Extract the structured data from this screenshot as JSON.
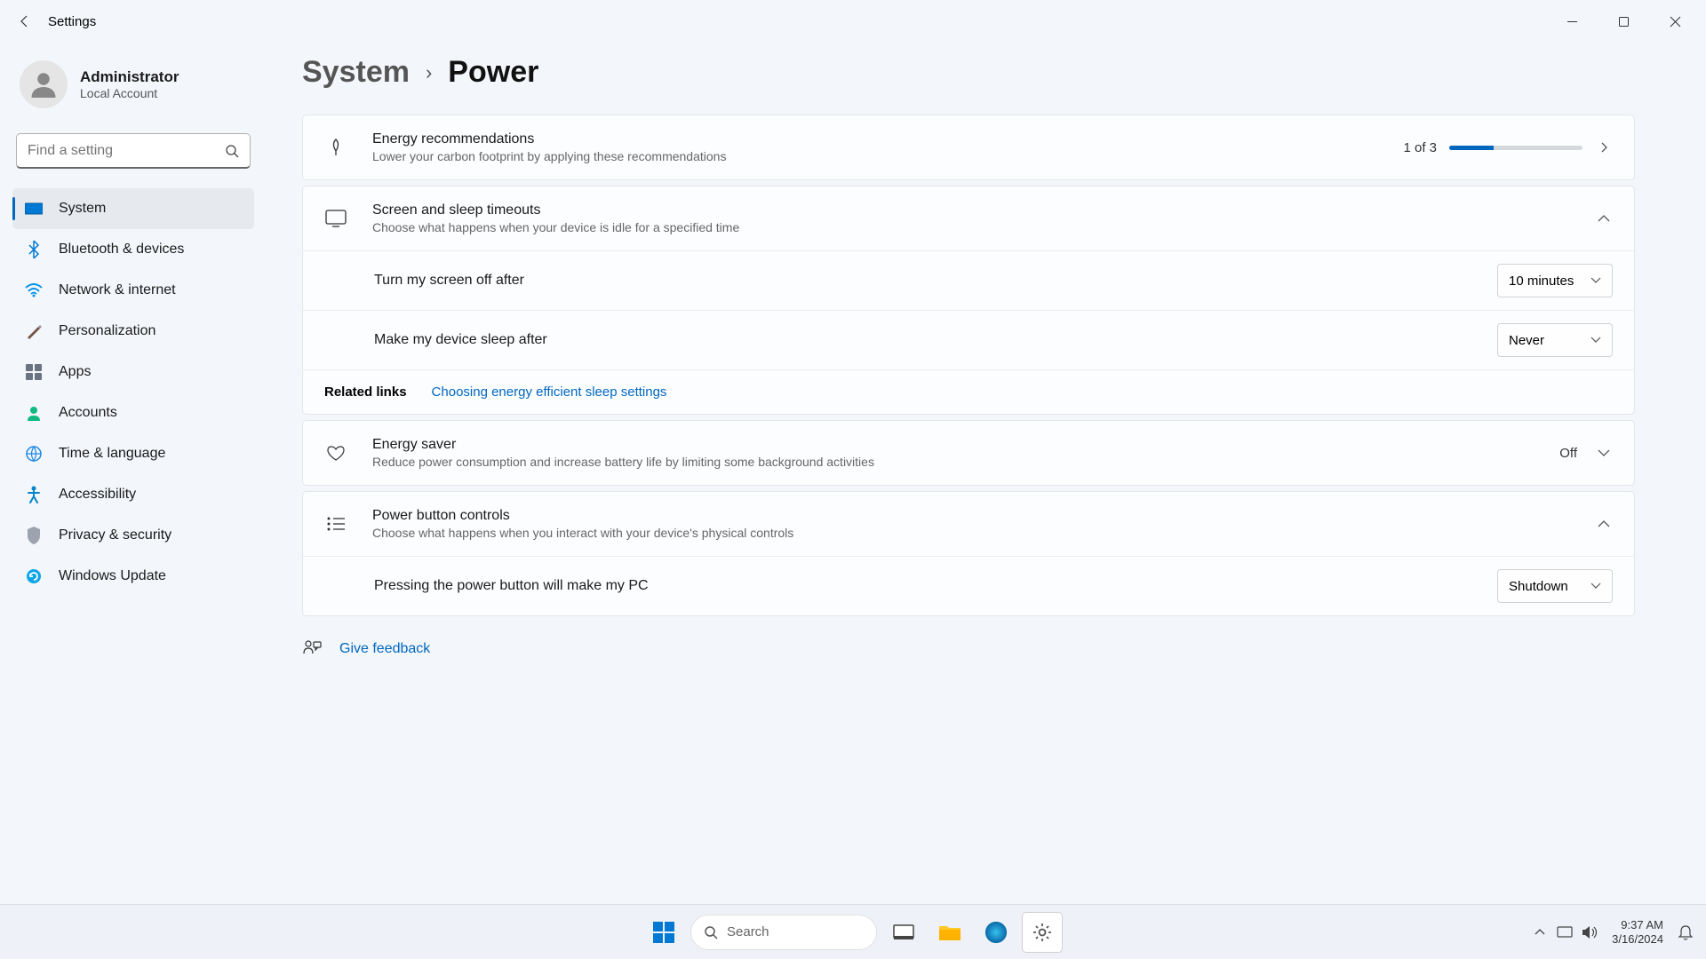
{
  "window": {
    "title": "Settings"
  },
  "user": {
    "name": "Administrator",
    "sub": "Local Account"
  },
  "search": {
    "placeholder": "Find a setting"
  },
  "nav": {
    "items": [
      {
        "label": "System"
      },
      {
        "label": "Bluetooth & devices"
      },
      {
        "label": "Network & internet"
      },
      {
        "label": "Personalization"
      },
      {
        "label": "Apps"
      },
      {
        "label": "Accounts"
      },
      {
        "label": "Time & language"
      },
      {
        "label": "Accessibility"
      },
      {
        "label": "Privacy & security"
      },
      {
        "label": "Windows Update"
      }
    ]
  },
  "breadcrumb": {
    "parent": "System",
    "current": "Power"
  },
  "energy_rec": {
    "title": "Energy recommendations",
    "desc": "Lower your carbon footprint by applying these recommendations",
    "progress_text": "1 of 3"
  },
  "sleep": {
    "title": "Screen and sleep timeouts",
    "desc": "Choose what happens when your device is idle for a specified time",
    "screen_label": "Turn my screen off after",
    "screen_value": "10 minutes",
    "sleep_label": "Make my device sleep after",
    "sleep_value": "Never"
  },
  "related": {
    "label": "Related links",
    "link": "Choosing energy efficient sleep settings"
  },
  "energy_saver": {
    "title": "Energy saver",
    "desc": "Reduce power consumption and increase battery life by limiting some background activities",
    "state": "Off"
  },
  "power_button": {
    "title": "Power button controls",
    "desc": "Choose what happens when you interact with your device's physical controls",
    "press_label": "Pressing the power button will make my PC",
    "press_value": "Shutdown"
  },
  "feedback": {
    "label": "Give feedback"
  },
  "taskbar": {
    "search": "Search",
    "time": "9:37 AM",
    "date": "3/16/2024"
  }
}
